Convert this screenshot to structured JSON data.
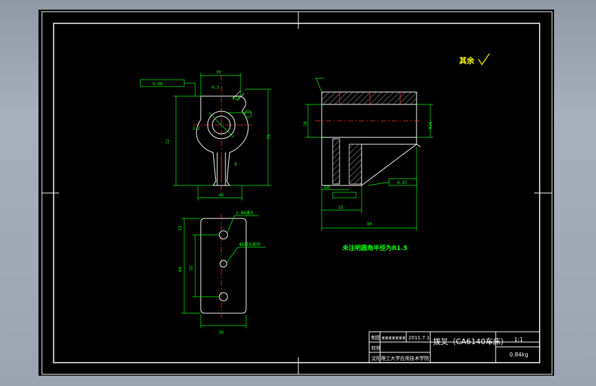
{
  "drawing": {
    "notes": {
      "rest_finish": "其余",
      "fillet_note": "未注明圆角半径为R1.5"
    },
    "title_block": {
      "drawn_label": "制图",
      "drawn_name": "某某某某某某某",
      "date": "2011.7.1",
      "check_label": "校核",
      "part_name": "拨叉（CA6140车床）",
      "scale": "1:1",
      "weight": "0.84kg",
      "school": "沈阳理工大学应用技术学院"
    },
    "dims": {
      "top_width": "30",
      "left_height": "72",
      "right_height": "75",
      "bottom_width": "40",
      "dia_label": "Φ22",
      "small_dim": "8",
      "side_width": "60",
      "side_total": "80",
      "side_mid": "35",
      "side_height": "16",
      "side_dia": "Φ26",
      "tol_flat": "0.08",
      "tol_perp": "0.07",
      "plan_width": "30",
      "plan_top": "15",
      "plan_mid": "35",
      "plan_height": "69",
      "hole_note_a": "2-Φ8通孔",
      "hole_note_b": "Φ8锥孔配作",
      "surface_a": "3.2",
      "surface_b": "6.3"
    }
  }
}
